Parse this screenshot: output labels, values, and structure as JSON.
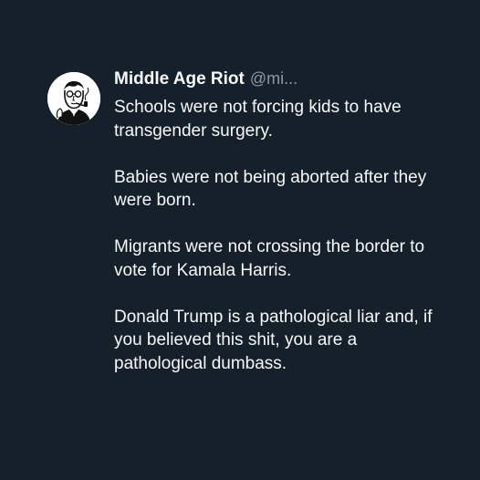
{
  "tweet": {
    "author": {
      "display_name": "Middle Age Riot",
      "handle": "@mi...",
      "avatar_icon": "man-smoking-pipe-avatar-icon"
    },
    "paragraphs": [
      "Schools were not forcing kids to have transgender surgery.",
      "Babies were not being aborted after they were born.",
      "Migrants were not crossing the border to vote for Kamala Harris.",
      "Donald Trump is a pathological liar and, if you believed this shit, you are a pathological dumbass."
    ]
  },
  "colors": {
    "background": "#15202b",
    "text_primary": "#f7f9f9",
    "text_secondary": "#8b98a5",
    "avatar_background": "#ffffff"
  }
}
